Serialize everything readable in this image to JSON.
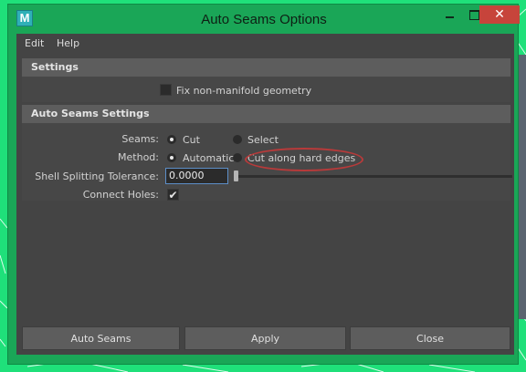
{
  "window": {
    "title": "Auto Seams Options",
    "app_icon_letter": "M",
    "close_glyph": "✕"
  },
  "menubar": {
    "items": [
      "Edit",
      "Help"
    ]
  },
  "settings": {
    "header": "Settings",
    "fix_non_manifold": {
      "label": "Fix non-manifold geometry",
      "checked": false
    }
  },
  "auto_seams_settings": {
    "header": "Auto Seams Settings",
    "seams": {
      "label": "Seams:",
      "options": [
        "Cut",
        "Select"
      ],
      "selected": "Cut"
    },
    "method": {
      "label": "Method:",
      "options": [
        "Automatic",
        "Cut along hard edges"
      ],
      "selected": "Automatic"
    },
    "shell_splitting_tolerance": {
      "label": "Shell Splitting Tolerance:",
      "value": "0.0000",
      "slider_fraction": 0
    },
    "connect_holes": {
      "label": "Connect Holes:",
      "checked": true,
      "check_glyph": "✔"
    }
  },
  "buttons": {
    "auto_seams": "Auto Seams",
    "apply": "Apply",
    "close": "Close"
  },
  "colors": {
    "accent_annotation": "#b83a3a",
    "window_frame": "#1aa657",
    "panel": "#444444"
  }
}
